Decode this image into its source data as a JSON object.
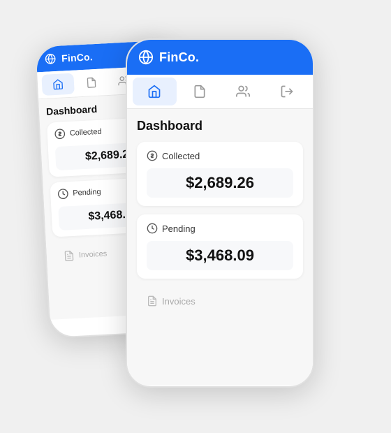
{
  "app": {
    "name": "FinCo.",
    "header_title": "FinCo.",
    "accent_color": "#1a6ef5",
    "bg_color": "#f0f0f0"
  },
  "nav": {
    "tabs": [
      {
        "label": "Home",
        "icon": "home-icon",
        "active": true
      },
      {
        "label": "Documents",
        "icon": "document-icon",
        "active": false
      },
      {
        "label": "Users",
        "icon": "users-icon",
        "active": false
      },
      {
        "label": "Logout",
        "icon": "logout-icon",
        "active": false
      }
    ]
  },
  "dashboard": {
    "title": "Dashboard",
    "cards": [
      {
        "label": "Collected",
        "icon": "dollar-icon",
        "value": "$2,689.26"
      },
      {
        "label": "Pending",
        "icon": "clock-icon",
        "value": "$3,468.09"
      }
    ],
    "invoices_label": "Invoices"
  }
}
